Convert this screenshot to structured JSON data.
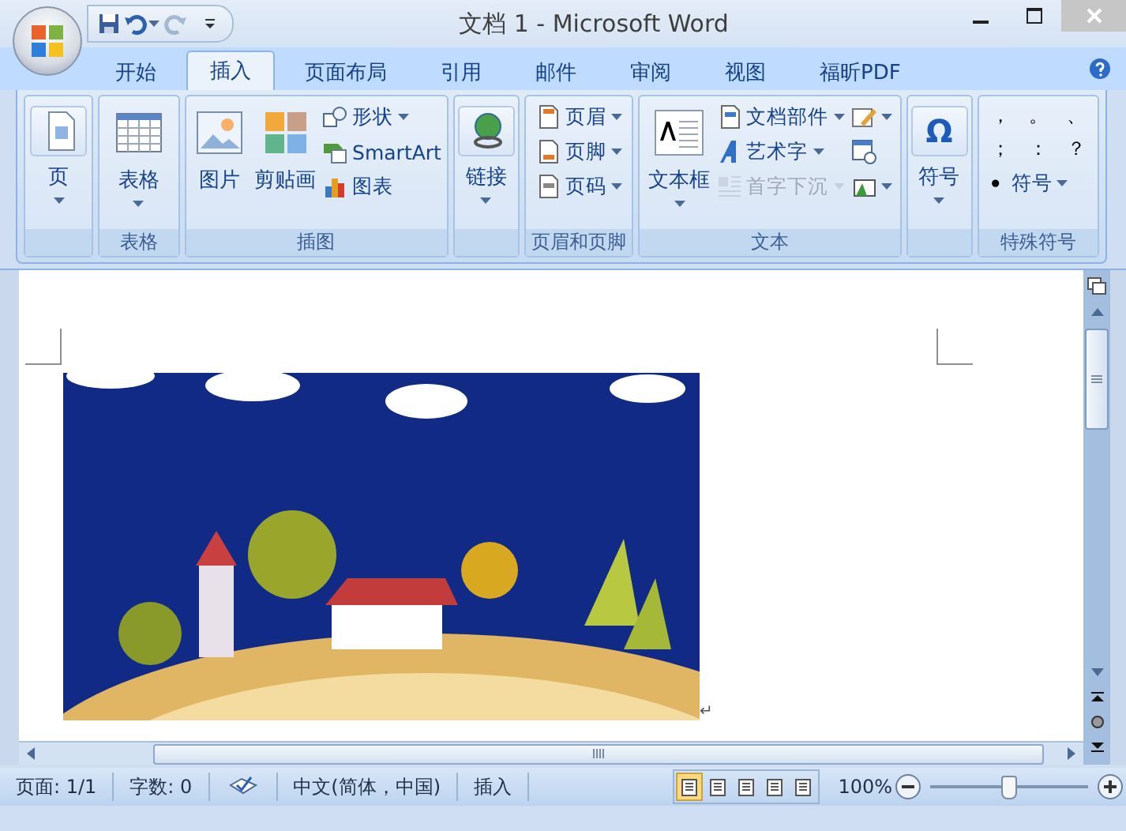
{
  "window": {
    "title": "文档 1 - Microsoft Word"
  },
  "quick_access": [
    {
      "dropdown": false,
      "disabled": false
    },
    {
      "dropdown": true,
      "disabled": false
    },
    {
      "dropdown": false,
      "disabled": true
    }
  ],
  "tabs": [
    {
      "label": "开始",
      "selected": false
    },
    {
      "label": "插入",
      "selected": true
    },
    {
      "label": "页面布局",
      "selected": false
    },
    {
      "label": "引用",
      "selected": false
    },
    {
      "label": "邮件",
      "selected": false
    },
    {
      "label": "审阅",
      "selected": false
    },
    {
      "label": "视图",
      "selected": false
    },
    {
      "label": "福昕PDF",
      "selected": false
    }
  ],
  "ribbon_groups": [
    {
      "columns": [
        [
          {
            "kind": "large",
            "label": "页",
            "dropdown": true,
            "disabled": false
          }
        ]
      ]
    },
    {
      "label": "表格",
      "columns": [
        [
          {
            "kind": "large",
            "label": "表格",
            "dropdown": true,
            "disabled": false
          }
        ]
      ]
    },
    {
      "label": "插图",
      "columns": [
        [
          {
            "kind": "large",
            "label": "图片",
            "dropdown": false,
            "disabled": false
          }
        ],
        [
          {
            "kind": "large",
            "label": "剪贴画",
            "dropdown": false,
            "disabled": false
          }
        ],
        [
          {
            "kind": "small",
            "label": "形状",
            "dropdown": true,
            "disabled": false
          },
          {
            "kind": "small",
            "label": "SmartArt",
            "dropdown": false,
            "disabled": false
          },
          {
            "kind": "small",
            "label": "图表",
            "dropdown": false,
            "disabled": false
          }
        ]
      ]
    },
    {
      "columns": [
        [
          {
            "kind": "large",
            "label": "链接",
            "dropdown": true,
            "disabled": false
          }
        ]
      ]
    },
    {
      "label": "页眉和页脚",
      "columns": [
        [
          {
            "kind": "small",
            "label": "页眉",
            "dropdown": true,
            "disabled": false
          },
          {
            "kind": "small",
            "label": "页脚",
            "dropdown": true,
            "disabled": false
          },
          {
            "kind": "small",
            "label": "页码",
            "dropdown": true,
            "disabled": false
          }
        ]
      ]
    },
    {
      "label": "文本",
      "columns": [
        [
          {
            "kind": "large",
            "label": "文本框",
            "dropdown": true,
            "disabled": false
          }
        ],
        [
          {
            "kind": "small",
            "label": "文档部件",
            "dropdown": true,
            "disabled": false
          },
          {
            "kind": "small",
            "label": "艺术字",
            "dropdown": true,
            "disabled": false
          },
          {
            "kind": "small",
            "label": "首字下沉",
            "dropdown": true,
            "disabled": true
          }
        ],
        [
          {
            "kind": "small",
            "dropdown": true,
            "disabled": false
          },
          {
            "kind": "small",
            "dropdown": false,
            "disabled": false
          },
          {
            "kind": "small",
            "dropdown": true,
            "disabled": false
          }
        ]
      ]
    },
    {
      "columns": [
        [
          {
            "kind": "large",
            "glyph": "Ω",
            "label": "符号",
            "dropdown": true,
            "disabled": false
          }
        ]
      ]
    },
    {
      "label": "特殊符号",
      "columns": [
        [
          {
            "kind": "symbols",
            "symbols": [
              "，",
              "。",
              "、",
              "；",
              "：",
              "？"
            ]
          },
          {
            "kind": "small",
            "glyph": "•",
            "label": "符号",
            "dropdown": true,
            "disabled": false
          }
        ]
      ]
    }
  ],
  "document": {
    "paragraph_mark": "↵"
  },
  "status_bar": {
    "items": [
      {
        "kind": "text",
        "label": "页面: 1/1"
      },
      {
        "kind": "text",
        "label": "字数: 0"
      },
      {
        "kind": "icon"
      },
      {
        "kind": "text",
        "label": "中文(简体，中国)"
      },
      {
        "kind": "text",
        "label": "插入"
      }
    ],
    "view_buttons": [
      {
        "selected": true
      },
      {
        "selected": false
      },
      {
        "selected": false
      },
      {
        "selected": false
      },
      {
        "selected": false
      }
    ],
    "zoom": {
      "label": "100%",
      "level": 0.5
    }
  }
}
